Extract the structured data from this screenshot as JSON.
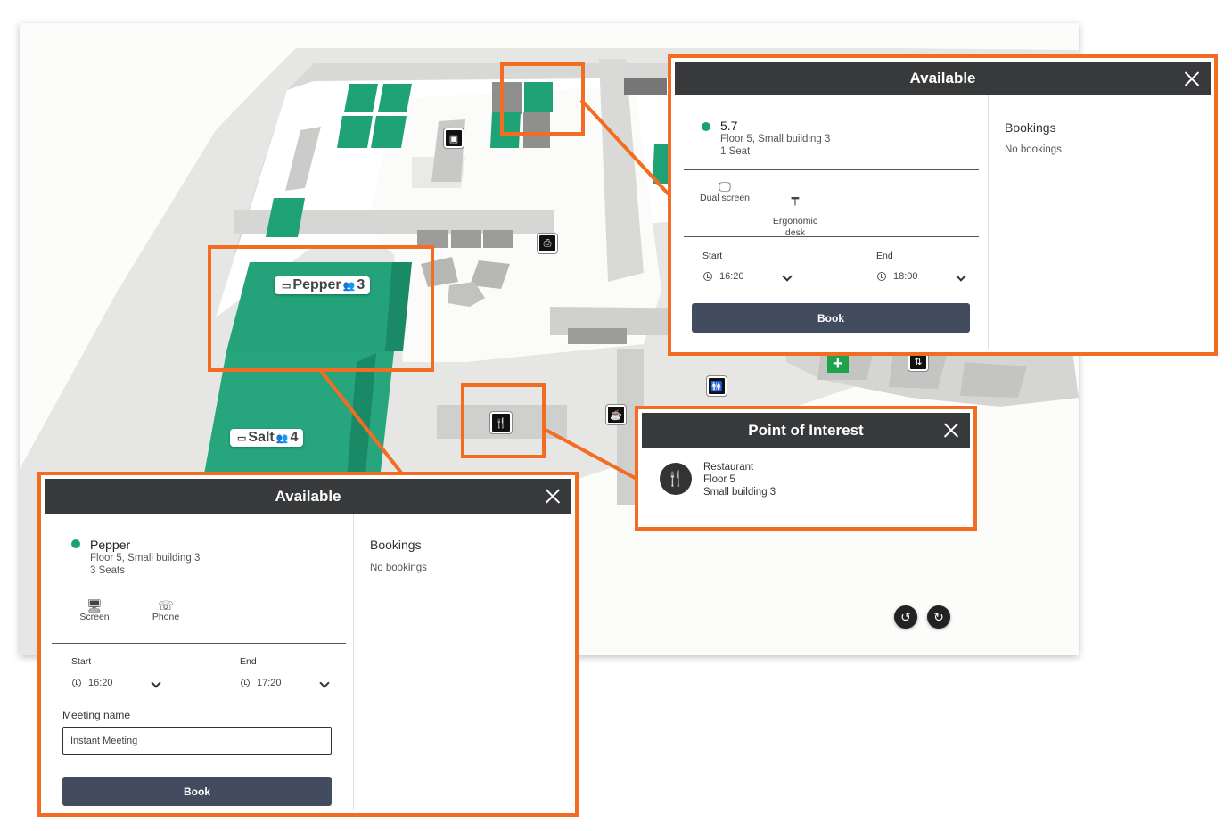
{
  "map": {
    "rooms": [
      {
        "name": "Pepper",
        "seats": "3"
      },
      {
        "name": "Salt",
        "seats": "4"
      }
    ],
    "controls": {
      "rotate_left": "↺",
      "rotate_right": "↻"
    }
  },
  "panel_room": {
    "header": "Available",
    "name": "Pepper",
    "location": "Floor 5, Small building 3",
    "seats": "3 Seats",
    "amenities": [
      {
        "label": "Screen",
        "icon": "monitor-icon"
      },
      {
        "label": "Phone",
        "icon": "phone-icon"
      }
    ],
    "start_label": "Start",
    "start_value": "16:20",
    "end_label": "End",
    "end_value": "17:20",
    "meeting_label": "Meeting name",
    "meeting_value": "Instant Meeting",
    "book_label": "Book",
    "bookings_title": "Bookings",
    "bookings_empty": "No bookings"
  },
  "panel_desk": {
    "header": "Available",
    "name": "5.7",
    "location": "Floor 5, Small building 3",
    "seats": "1 Seat",
    "amenities": [
      {
        "label": "Dual screen",
        "icon": "dual-screen-icon"
      },
      {
        "label": "Ergonomic\ndesk",
        "icon": "ergonomic-desk-icon"
      }
    ],
    "start_label": "Start",
    "start_value": "16:20",
    "end_label": "End",
    "end_value": "18:00",
    "book_label": "Book",
    "bookings_title": "Bookings",
    "bookings_empty": "No bookings"
  },
  "panel_poi": {
    "header": "Point of Interest",
    "name": "Restaurant",
    "floor": "Floor 5",
    "building": "Small building 3"
  },
  "colors": {
    "accent": "#f26c21",
    "green": "#1f9f77",
    "header": "#38393b",
    "button": "#434c5e"
  }
}
